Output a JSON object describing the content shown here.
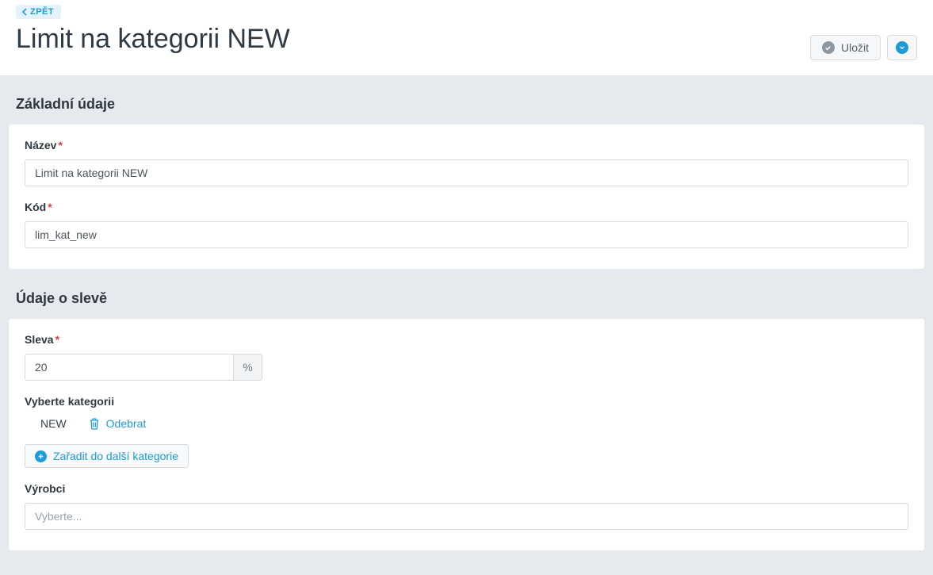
{
  "header": {
    "back_label": "ZPĚT",
    "title": "Limit na kategorii NEW",
    "save_label": "Uložit"
  },
  "sections": {
    "basic": {
      "title": "Základní údaje",
      "name_label": "Název",
      "name_value": "Limit na kategorii NEW",
      "code_label": "Kód",
      "code_value": "lim_kat_new"
    },
    "discount": {
      "title": "Údaje o slevě",
      "discount_label": "Sleva",
      "discount_value": "20",
      "discount_unit": "%",
      "category_label": "Vyberte kategorii",
      "category_name": "NEW",
      "remove_label": "Odebrat",
      "add_category_label": "Zařadit do další kategorie",
      "manufacturers_label": "Výrobci",
      "manufacturers_placeholder": "Vyberte..."
    }
  }
}
